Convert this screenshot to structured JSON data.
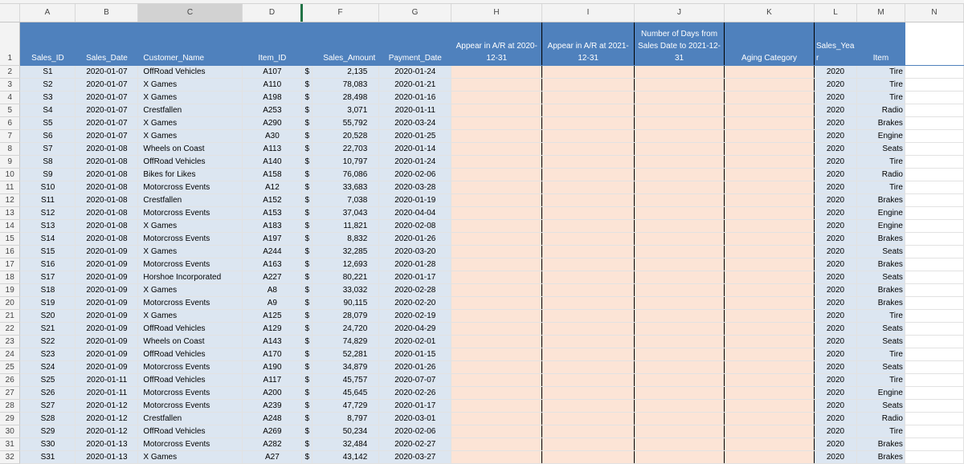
{
  "columns": [
    "A",
    "B",
    "C",
    "D",
    "F",
    "G",
    "H",
    "I",
    "J",
    "K",
    "L",
    "M",
    "N"
  ],
  "selected_column": "C",
  "headers": {
    "sales_id": "Sales_ID",
    "sales_date": "Sales_Date",
    "customer_name": "Customer_Name",
    "item_id": "Item_ID",
    "sales_amount": "Sales_Amount",
    "payment_date": "Payment_Date",
    "ar_2020": "Appear in A/R at 2020-12-31",
    "ar_2021": "Appear in A/R at 2021-12-31",
    "days_from_sales": "Number of Days from Sales Date to 2021-12-31",
    "aging_category": "Aging Category",
    "sales_year": "Sales_Yea r",
    "item": "Item"
  },
  "currency_symbol": "$",
  "rows": [
    {
      "n": "2",
      "id": "S1",
      "date": "2020-01-07",
      "cust": "OffRoad Vehicles",
      "item_id": "A107",
      "amt": "2,135",
      "pay": "2020-01-24",
      "year": "2020",
      "item": "Tire"
    },
    {
      "n": "3",
      "id": "S2",
      "date": "2020-01-07",
      "cust": "X Games",
      "item_id": "A110",
      "amt": "78,083",
      "pay": "2020-01-21",
      "year": "2020",
      "item": "Tire"
    },
    {
      "n": "4",
      "id": "S3",
      "date": "2020-01-07",
      "cust": "X Games",
      "item_id": "A198",
      "amt": "28,498",
      "pay": "2020-01-16",
      "year": "2020",
      "item": "Tire"
    },
    {
      "n": "5",
      "id": "S4",
      "date": "2020-01-07",
      "cust": "Crestfallen",
      "item_id": "A253",
      "amt": "3,071",
      "pay": "2020-01-11",
      "year": "2020",
      "item": "Radio"
    },
    {
      "n": "6",
      "id": "S5",
      "date": "2020-01-07",
      "cust": "X Games",
      "item_id": "A290",
      "amt": "55,792",
      "pay": "2020-03-24",
      "year": "2020",
      "item": "Brakes"
    },
    {
      "n": "7",
      "id": "S6",
      "date": "2020-01-07",
      "cust": "X Games",
      "item_id": "A30",
      "amt": "20,528",
      "pay": "2020-01-25",
      "year": "2020",
      "item": "Engine"
    },
    {
      "n": "8",
      "id": "S7",
      "date": "2020-01-08",
      "cust": "Wheels on Coast",
      "item_id": "A113",
      "amt": "22,703",
      "pay": "2020-01-14",
      "year": "2020",
      "item": "Seats"
    },
    {
      "n": "9",
      "id": "S8",
      "date": "2020-01-08",
      "cust": "OffRoad Vehicles",
      "item_id": "A140",
      "amt": "10,797",
      "pay": "2020-01-24",
      "year": "2020",
      "item": "Tire"
    },
    {
      "n": "10",
      "id": "S9",
      "date": "2020-01-08",
      "cust": "Bikes for Likes",
      "item_id": "A158",
      "amt": "76,086",
      "pay": "2020-02-06",
      "year": "2020",
      "item": "Radio"
    },
    {
      "n": "11",
      "id": "S10",
      "date": "2020-01-08",
      "cust": "Motorcross Events",
      "item_id": "A12",
      "amt": "33,683",
      "pay": "2020-03-28",
      "year": "2020",
      "item": "Tire"
    },
    {
      "n": "12",
      "id": "S11",
      "date": "2020-01-08",
      "cust": "Crestfallen",
      "item_id": "A152",
      "amt": "7,038",
      "pay": "2020-01-19",
      "year": "2020",
      "item": "Brakes"
    },
    {
      "n": "13",
      "id": "S12",
      "date": "2020-01-08",
      "cust": "Motorcross Events",
      "item_id": "A153",
      "amt": "37,043",
      "pay": "2020-04-04",
      "year": "2020",
      "item": "Engine"
    },
    {
      "n": "14",
      "id": "S13",
      "date": "2020-01-08",
      "cust": "X Games",
      "item_id": "A183",
      "amt": "11,821",
      "pay": "2020-02-08",
      "year": "2020",
      "item": "Engine"
    },
    {
      "n": "15",
      "id": "S14",
      "date": "2020-01-08",
      "cust": "Motorcross Events",
      "item_id": "A197",
      "amt": "8,832",
      "pay": "2020-01-26",
      "year": "2020",
      "item": "Brakes"
    },
    {
      "n": "16",
      "id": "S15",
      "date": "2020-01-09",
      "cust": "X Games",
      "item_id": "A244",
      "amt": "32,285",
      "pay": "2020-03-20",
      "year": "2020",
      "item": "Seats"
    },
    {
      "n": "17",
      "id": "S16",
      "date": "2020-01-09",
      "cust": "Motorcross Events",
      "item_id": "A163",
      "amt": "12,693",
      "pay": "2020-01-28",
      "year": "2020",
      "item": "Brakes"
    },
    {
      "n": "18",
      "id": "S17",
      "date": "2020-01-09",
      "cust": "Horshoe Incorporated",
      "item_id": "A227",
      "amt": "80,221",
      "pay": "2020-01-17",
      "year": "2020",
      "item": "Seats"
    },
    {
      "n": "19",
      "id": "S18",
      "date": "2020-01-09",
      "cust": "X Games",
      "item_id": "A8",
      "amt": "33,032",
      "pay": "2020-02-28",
      "year": "2020",
      "item": "Brakes"
    },
    {
      "n": "20",
      "id": "S19",
      "date": "2020-01-09",
      "cust": "Motorcross Events",
      "item_id": "A9",
      "amt": "90,115",
      "pay": "2020-02-20",
      "year": "2020",
      "item": "Brakes"
    },
    {
      "n": "21",
      "id": "S20",
      "date": "2020-01-09",
      "cust": "X Games",
      "item_id": "A125",
      "amt": "28,079",
      "pay": "2020-02-19",
      "year": "2020",
      "item": "Tire"
    },
    {
      "n": "22",
      "id": "S21",
      "date": "2020-01-09",
      "cust": "OffRoad Vehicles",
      "item_id": "A129",
      "amt": "24,720",
      "pay": "2020-04-29",
      "year": "2020",
      "item": "Seats"
    },
    {
      "n": "23",
      "id": "S22",
      "date": "2020-01-09",
      "cust": "Wheels on Coast",
      "item_id": "A143",
      "amt": "74,829",
      "pay": "2020-02-01",
      "year": "2020",
      "item": "Seats"
    },
    {
      "n": "24",
      "id": "S23",
      "date": "2020-01-09",
      "cust": "OffRoad Vehicles",
      "item_id": "A170",
      "amt": "52,281",
      "pay": "2020-01-15",
      "year": "2020",
      "item": "Tire"
    },
    {
      "n": "25",
      "id": "S24",
      "date": "2020-01-09",
      "cust": "Motorcross Events",
      "item_id": "A190",
      "amt": "34,879",
      "pay": "2020-01-26",
      "year": "2020",
      "item": "Seats"
    },
    {
      "n": "26",
      "id": "S25",
      "date": "2020-01-11",
      "cust": "OffRoad Vehicles",
      "item_id": "A117",
      "amt": "45,757",
      "pay": "2020-07-07",
      "year": "2020",
      "item": "Tire"
    },
    {
      "n": "27",
      "id": "S26",
      "date": "2020-01-11",
      "cust": "Motorcross Events",
      "item_id": "A200",
      "amt": "45,645",
      "pay": "2020-02-26",
      "year": "2020",
      "item": "Engine"
    },
    {
      "n": "28",
      "id": "S27",
      "date": "2020-01-12",
      "cust": "Motorcross Events",
      "item_id": "A239",
      "amt": "47,729",
      "pay": "2020-01-17",
      "year": "2020",
      "item": "Seats"
    },
    {
      "n": "29",
      "id": "S28",
      "date": "2020-01-12",
      "cust": "Crestfallen",
      "item_id": "A248",
      "amt": "8,797",
      "pay": "2020-03-01",
      "year": "2020",
      "item": "Radio"
    },
    {
      "n": "30",
      "id": "S29",
      "date": "2020-01-12",
      "cust": "OffRoad Vehicles",
      "item_id": "A269",
      "amt": "50,234",
      "pay": "2020-02-06",
      "year": "2020",
      "item": "Tire"
    },
    {
      "n": "31",
      "id": "S30",
      "date": "2020-01-13",
      "cust": "Motorcross Events",
      "item_id": "A282",
      "amt": "32,484",
      "pay": "2020-02-27",
      "year": "2020",
      "item": "Brakes"
    },
    {
      "n": "32",
      "id": "S31",
      "date": "2020-01-13",
      "cust": "X Games",
      "item_id": "A27",
      "amt": "43,142",
      "pay": "2020-03-27",
      "year": "2020",
      "item": "Brakes"
    }
  ],
  "colors": {
    "header_blue": "#4f81bd",
    "data_blue": "#dce6f1",
    "peach": "#fce4d6",
    "selected_col": "#217346"
  }
}
